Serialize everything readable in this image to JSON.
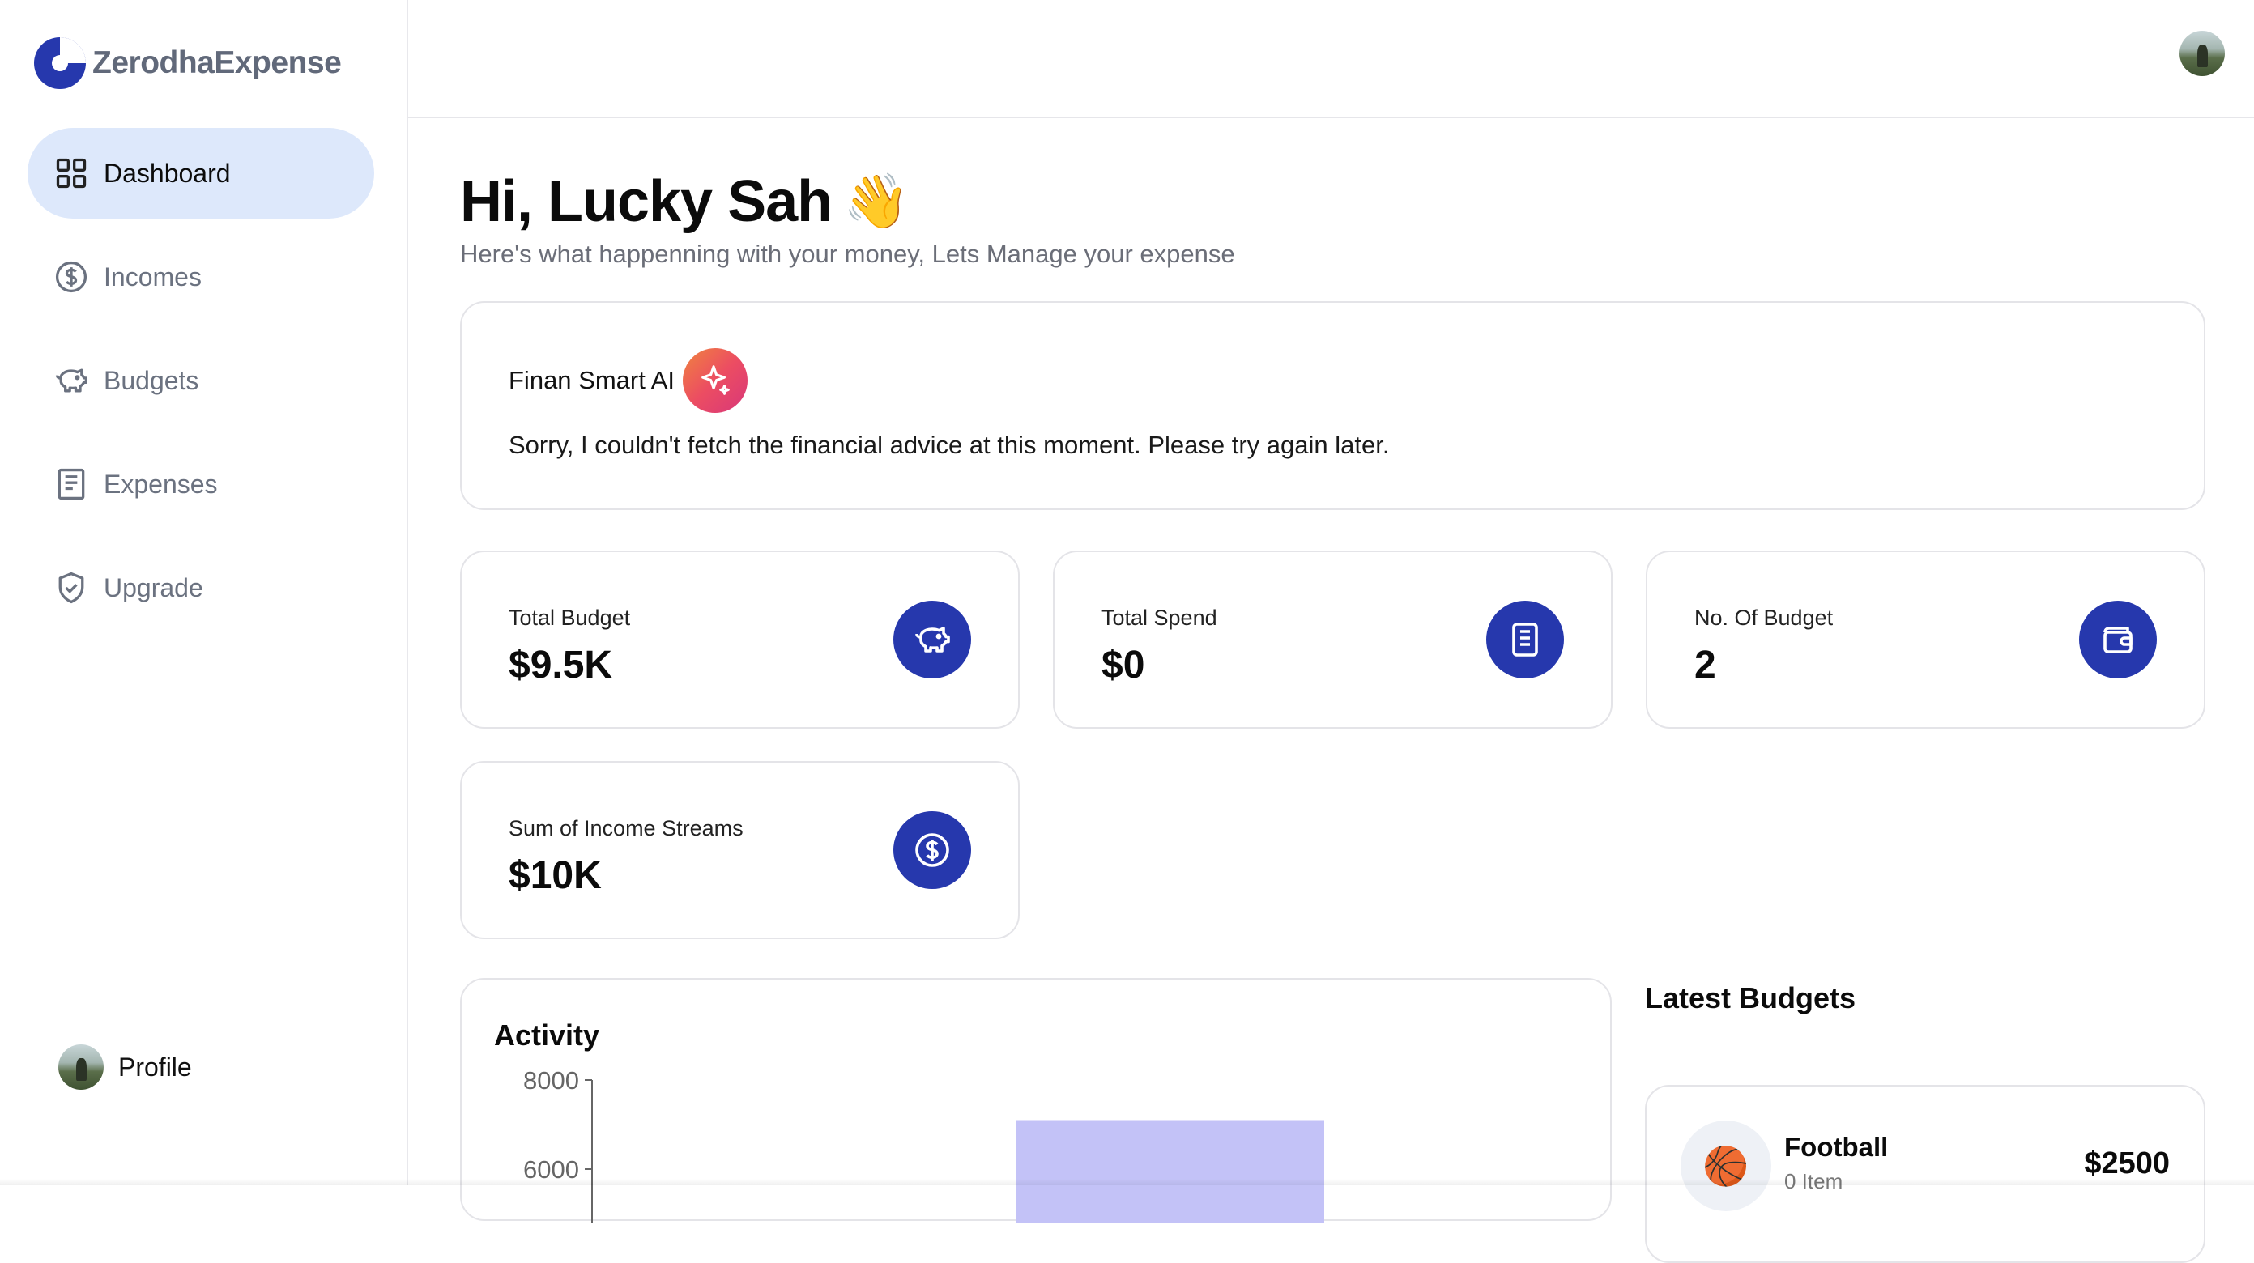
{
  "app": {
    "name": "ZerodhaExpense",
    "accent": "#2638ad",
    "active_nav_bg": "#dde8fb"
  },
  "sidebar": {
    "items": [
      {
        "label": "Dashboard",
        "icon": "dashboard-grid-icon",
        "active": true
      },
      {
        "label": "Incomes",
        "icon": "dollar-circle-icon",
        "active": false
      },
      {
        "label": "Budgets",
        "icon": "piggy-bank-icon",
        "active": false
      },
      {
        "label": "Expenses",
        "icon": "receipt-icon",
        "active": false
      },
      {
        "label": "Upgrade",
        "icon": "shield-check-icon",
        "active": false
      }
    ],
    "profile_label": "Profile"
  },
  "greeting": {
    "title": "Hi, Lucky Sah",
    "emoji": "👋",
    "subtitle": "Here's what happenning with your money, Lets Manage your expense"
  },
  "ai_card": {
    "title": "Finan Smart AI",
    "icon": "sparkle-icon",
    "message": "Sorry, I couldn't fetch the financial advice at this moment. Please try again later."
  },
  "stats": [
    {
      "label": "Total Budget",
      "value": "$9.5K",
      "icon": "piggy-bank-icon"
    },
    {
      "label": "Total Spend",
      "value": "$0",
      "icon": "receipt-icon"
    },
    {
      "label": "No. Of Budget",
      "value": "2",
      "icon": "wallet-icon"
    },
    {
      "label": "Sum of Income Streams",
      "value": "$10K",
      "icon": "dollar-circle-icon"
    }
  ],
  "activity": {
    "title": "Activity",
    "chart_data": {
      "type": "bar",
      "title": "Activity",
      "xlabel": "",
      "ylabel": "",
      "yticks": [
        "8000",
        "6000"
      ],
      "ylim": [
        0,
        8000
      ],
      "categories": [
        ""
      ],
      "values": [
        7100
      ],
      "bar_color": "#c3c2f7"
    }
  },
  "latest_budgets": {
    "title": "Latest Budgets",
    "items": [
      {
        "name": "Football",
        "items_text": "0 Item",
        "amount": "$2500",
        "emoji": "🏀"
      }
    ]
  }
}
